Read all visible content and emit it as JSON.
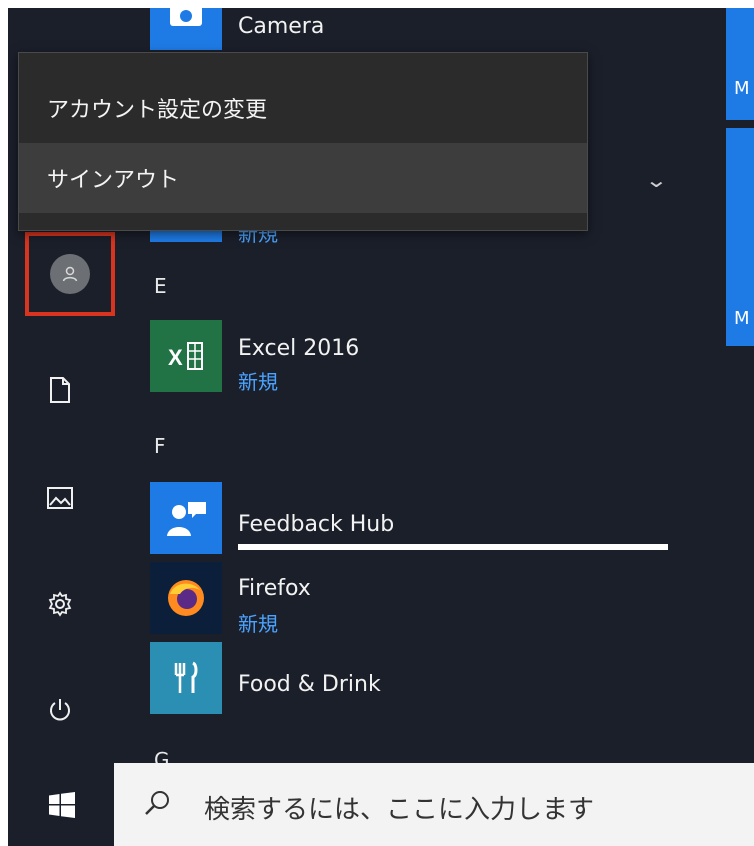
{
  "start_menu": {
    "account_menu": {
      "change_account_settings": "アカウント設定の変更",
      "sign_out": "サインアウト"
    },
    "rail_icons": [
      "user-avatar-icon",
      "document-icon",
      "pictures-icon",
      "settings-gear-icon",
      "power-icon"
    ],
    "apps": {
      "camera": {
        "name": "Camera"
      },
      "partial_new_label": "新規",
      "letter_e": "E",
      "excel": {
        "name": "Excel 2016",
        "sub": "新規"
      },
      "letter_f": "F",
      "feedback": {
        "name": "Feedback Hub",
        "progress": 1.0
      },
      "firefox": {
        "name": "Firefox",
        "sub": "新規"
      },
      "food": {
        "name": "Food & Drink"
      },
      "letter_g": "G"
    },
    "right_tiles": [
      "M",
      "M"
    ]
  },
  "taskbar": {
    "search_placeholder": "検索するには、ここに入力します"
  },
  "colors": {
    "start_bg": "#1b1f2a",
    "accent": "#1e7be6",
    "highlight_border": "#d8341f",
    "new_label": "#4aa3ff",
    "excel_tile": "#217346",
    "feedback_tile": "#1e7be6",
    "firefox_tile": "#0b1f3a",
    "food_tile": "#2b8fb3"
  }
}
